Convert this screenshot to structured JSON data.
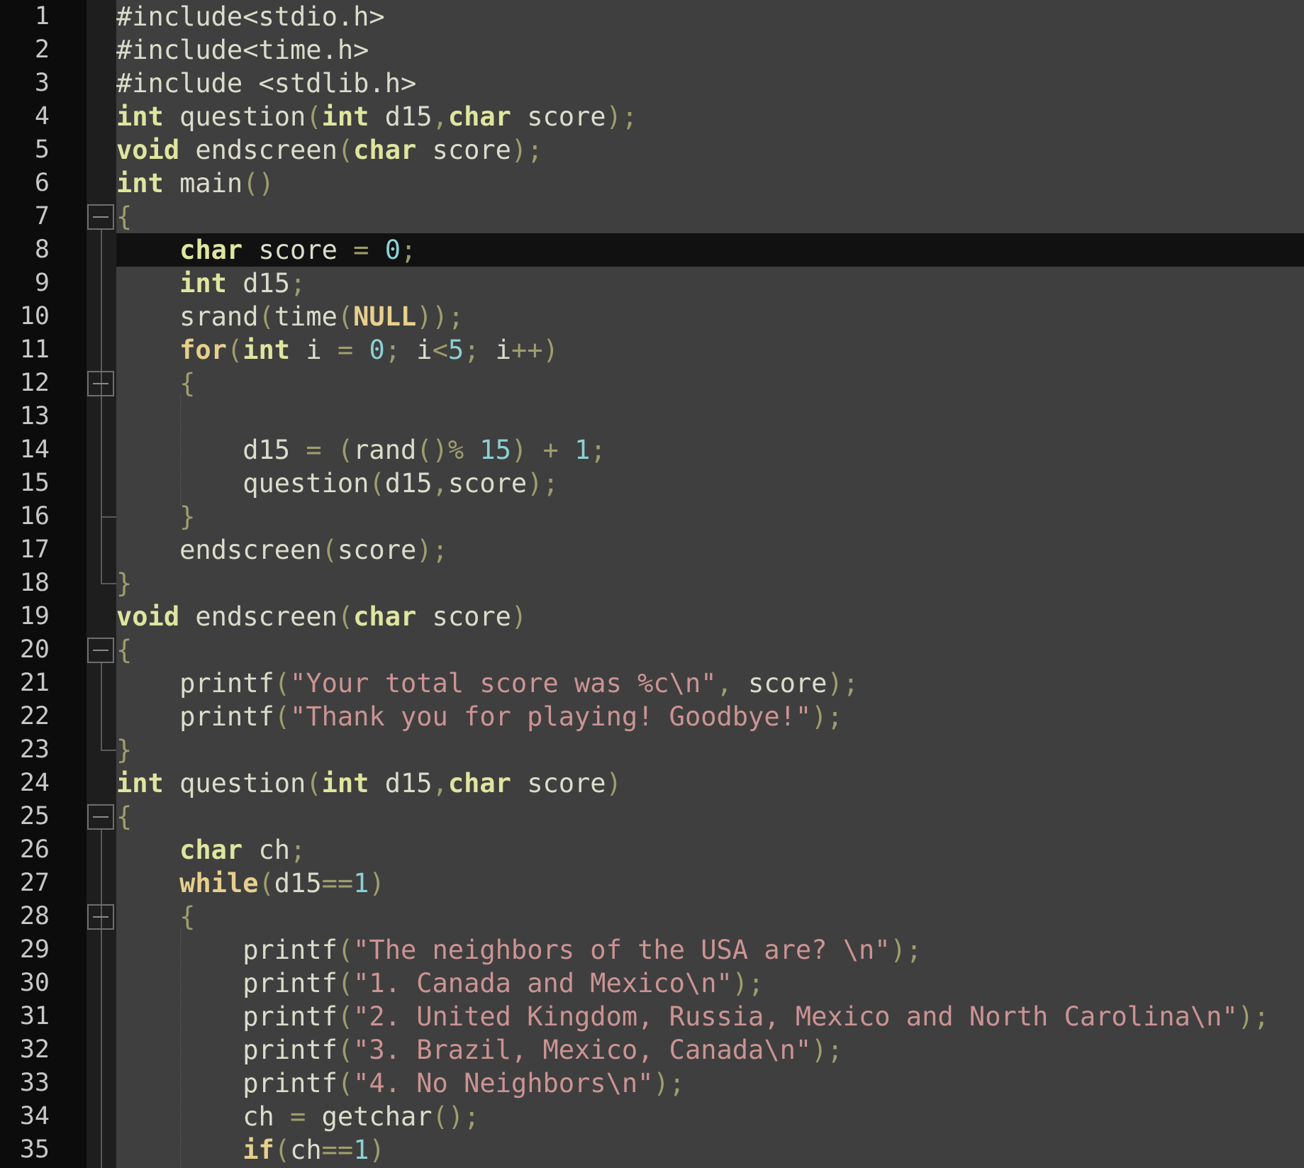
{
  "editor": {
    "language": "C",
    "current_line": 8,
    "colors": {
      "background": "#3f3f3f",
      "gutter": "#0c0c0c",
      "current_line": "#111111",
      "keyword": "#e7cf8d",
      "type": "#dfe59f",
      "number": "#8cd0d3",
      "string": "#cc9393",
      "punctuation": "#9f9d6d",
      "text": "#dcdccc"
    },
    "fold_markers_at_lines": [
      7,
      12,
      20,
      25,
      28
    ],
    "lines": [
      {
        "n": "1",
        "tokens": [
          [
            "pre",
            "#include<stdio.h>"
          ]
        ]
      },
      {
        "n": "2",
        "tokens": [
          [
            "pre",
            "#include<time.h>"
          ]
        ]
      },
      {
        "n": "3",
        "tokens": [
          [
            "pre",
            "#include <stdlib.h>"
          ]
        ]
      },
      {
        "n": "4",
        "tokens": [
          [
            "typ",
            "int"
          ],
          [
            "txt",
            " question"
          ],
          [
            "pun",
            "("
          ],
          [
            "typ",
            "int"
          ],
          [
            "txt",
            " d15"
          ],
          [
            "pun",
            ","
          ],
          [
            "typ",
            "char"
          ],
          [
            "txt",
            " score"
          ],
          [
            "pun",
            ");"
          ]
        ]
      },
      {
        "n": "5",
        "tokens": [
          [
            "typ",
            "void"
          ],
          [
            "txt",
            " endscreen"
          ],
          [
            "pun",
            "("
          ],
          [
            "typ",
            "char"
          ],
          [
            "txt",
            " score"
          ],
          [
            "pun",
            ");"
          ]
        ]
      },
      {
        "n": "6",
        "tokens": [
          [
            "typ",
            "int"
          ],
          [
            "txt",
            " main"
          ],
          [
            "pun",
            "()"
          ]
        ]
      },
      {
        "n": "7",
        "tokens": [
          [
            "pun",
            "{"
          ]
        ]
      },
      {
        "n": "8",
        "tokens": [
          [
            "txt",
            "    "
          ],
          [
            "typ",
            "char"
          ],
          [
            "txt",
            " score "
          ],
          [
            "pun",
            "="
          ],
          [
            "txt",
            " "
          ],
          [
            "num",
            "0"
          ],
          [
            "pun",
            ";"
          ]
        ]
      },
      {
        "n": "9",
        "tokens": [
          [
            "txt",
            "    "
          ],
          [
            "typ",
            "int"
          ],
          [
            "txt",
            " d15"
          ],
          [
            "pun",
            ";"
          ]
        ]
      },
      {
        "n": "10",
        "tokens": [
          [
            "txt",
            "    srand"
          ],
          [
            "pun",
            "("
          ],
          [
            "txt",
            "time"
          ],
          [
            "pun",
            "("
          ],
          [
            "kw",
            "NULL"
          ],
          [
            "pun",
            "));"
          ]
        ]
      },
      {
        "n": "11",
        "tokens": [
          [
            "txt",
            "    "
          ],
          [
            "kw",
            "for"
          ],
          [
            "pun",
            "("
          ],
          [
            "typ",
            "int"
          ],
          [
            "txt",
            " i "
          ],
          [
            "pun",
            "="
          ],
          [
            "txt",
            " "
          ],
          [
            "num",
            "0"
          ],
          [
            "pun",
            ";"
          ],
          [
            "txt",
            " i"
          ],
          [
            "pun",
            "<"
          ],
          [
            "num",
            "5"
          ],
          [
            "pun",
            ";"
          ],
          [
            "txt",
            " i"
          ],
          [
            "pun",
            "++)"
          ]
        ]
      },
      {
        "n": "12",
        "tokens": [
          [
            "txt",
            "    "
          ],
          [
            "pun",
            "{"
          ]
        ]
      },
      {
        "n": "13",
        "tokens": [
          [
            "txt",
            ""
          ]
        ]
      },
      {
        "n": "14",
        "tokens": [
          [
            "txt",
            "        d15 "
          ],
          [
            "pun",
            "="
          ],
          [
            "txt",
            " "
          ],
          [
            "pun",
            "("
          ],
          [
            "txt",
            "rand"
          ],
          [
            "pun",
            "()%"
          ],
          [
            "txt",
            " "
          ],
          [
            "num",
            "15"
          ],
          [
            "pun",
            ")"
          ],
          [
            "txt",
            " "
          ],
          [
            "pun",
            "+"
          ],
          [
            "txt",
            " "
          ],
          [
            "num",
            "1"
          ],
          [
            "pun",
            ";"
          ]
        ]
      },
      {
        "n": "15",
        "tokens": [
          [
            "txt",
            "        question"
          ],
          [
            "pun",
            "("
          ],
          [
            "txt",
            "d15"
          ],
          [
            "pun",
            ","
          ],
          [
            "txt",
            "score"
          ],
          [
            "pun",
            ");"
          ]
        ]
      },
      {
        "n": "16",
        "tokens": [
          [
            "txt",
            "    "
          ],
          [
            "pun",
            "}"
          ]
        ]
      },
      {
        "n": "17",
        "tokens": [
          [
            "txt",
            "    endscreen"
          ],
          [
            "pun",
            "("
          ],
          [
            "txt",
            "score"
          ],
          [
            "pun",
            ");"
          ]
        ]
      },
      {
        "n": "18",
        "tokens": [
          [
            "pun",
            "}"
          ]
        ]
      },
      {
        "n": "19",
        "tokens": [
          [
            "typ",
            "void"
          ],
          [
            "txt",
            " endscreen"
          ],
          [
            "pun",
            "("
          ],
          [
            "typ",
            "char"
          ],
          [
            "txt",
            " score"
          ],
          [
            "pun",
            ")"
          ]
        ]
      },
      {
        "n": "20",
        "tokens": [
          [
            "pun",
            "{"
          ]
        ]
      },
      {
        "n": "21",
        "tokens": [
          [
            "txt",
            "    printf"
          ],
          [
            "pun",
            "("
          ],
          [
            "str",
            "\"Your total score was %c\\n\""
          ],
          [
            "pun",
            ","
          ],
          [
            "txt",
            " score"
          ],
          [
            "pun",
            ");"
          ]
        ]
      },
      {
        "n": "22",
        "tokens": [
          [
            "txt",
            "    printf"
          ],
          [
            "pun",
            "("
          ],
          [
            "str",
            "\"Thank you for playing! Goodbye!\""
          ],
          [
            "pun",
            ");"
          ]
        ]
      },
      {
        "n": "23",
        "tokens": [
          [
            "pun",
            "}"
          ]
        ]
      },
      {
        "n": "24",
        "tokens": [
          [
            "typ",
            "int"
          ],
          [
            "txt",
            " question"
          ],
          [
            "pun",
            "("
          ],
          [
            "typ",
            "int"
          ],
          [
            "txt",
            " d15"
          ],
          [
            "pun",
            ","
          ],
          [
            "typ",
            "char"
          ],
          [
            "txt",
            " score"
          ],
          [
            "pun",
            ")"
          ]
        ]
      },
      {
        "n": "25",
        "tokens": [
          [
            "pun",
            "{"
          ]
        ]
      },
      {
        "n": "26",
        "tokens": [
          [
            "txt",
            "    "
          ],
          [
            "typ",
            "char"
          ],
          [
            "txt",
            " ch"
          ],
          [
            "pun",
            ";"
          ]
        ]
      },
      {
        "n": "27",
        "tokens": [
          [
            "txt",
            "    "
          ],
          [
            "kw",
            "while"
          ],
          [
            "pun",
            "("
          ],
          [
            "txt",
            "d15"
          ],
          [
            "pun",
            "=="
          ],
          [
            "num",
            "1"
          ],
          [
            "pun",
            ")"
          ]
        ]
      },
      {
        "n": "28",
        "tokens": [
          [
            "txt",
            "    "
          ],
          [
            "pun",
            "{"
          ]
        ]
      },
      {
        "n": "29",
        "tokens": [
          [
            "txt",
            "        printf"
          ],
          [
            "pun",
            "("
          ],
          [
            "str",
            "\"The neighbors of the USA are? \\n\""
          ],
          [
            "pun",
            ");"
          ]
        ]
      },
      {
        "n": "30",
        "tokens": [
          [
            "txt",
            "        printf"
          ],
          [
            "pun",
            "("
          ],
          [
            "str",
            "\"1. Canada and Mexico\\n\""
          ],
          [
            "pun",
            ");"
          ]
        ]
      },
      {
        "n": "31",
        "tokens": [
          [
            "txt",
            "        printf"
          ],
          [
            "pun",
            "("
          ],
          [
            "str",
            "\"2. United Kingdom, Russia, Mexico and North Carolina\\n\""
          ],
          [
            "pun",
            ");"
          ]
        ]
      },
      {
        "n": "32",
        "tokens": [
          [
            "txt",
            "        printf"
          ],
          [
            "pun",
            "("
          ],
          [
            "str",
            "\"3. Brazil, Mexico, Canada\\n\""
          ],
          [
            "pun",
            ");"
          ]
        ]
      },
      {
        "n": "33",
        "tokens": [
          [
            "txt",
            "        printf"
          ],
          [
            "pun",
            "("
          ],
          [
            "str",
            "\"4. No Neighbors\\n\""
          ],
          [
            "pun",
            ");"
          ]
        ]
      },
      {
        "n": "34",
        "tokens": [
          [
            "txt",
            "        ch "
          ],
          [
            "pun",
            "="
          ],
          [
            "txt",
            " getchar"
          ],
          [
            "pun",
            "();"
          ]
        ]
      },
      {
        "n": "35",
        "tokens": [
          [
            "txt",
            "        "
          ],
          [
            "kw",
            "if"
          ],
          [
            "pun",
            "("
          ],
          [
            "txt",
            "ch"
          ],
          [
            "pun",
            "=="
          ],
          [
            "num",
            "1"
          ],
          [
            "pun",
            ")"
          ]
        ]
      }
    ]
  }
}
